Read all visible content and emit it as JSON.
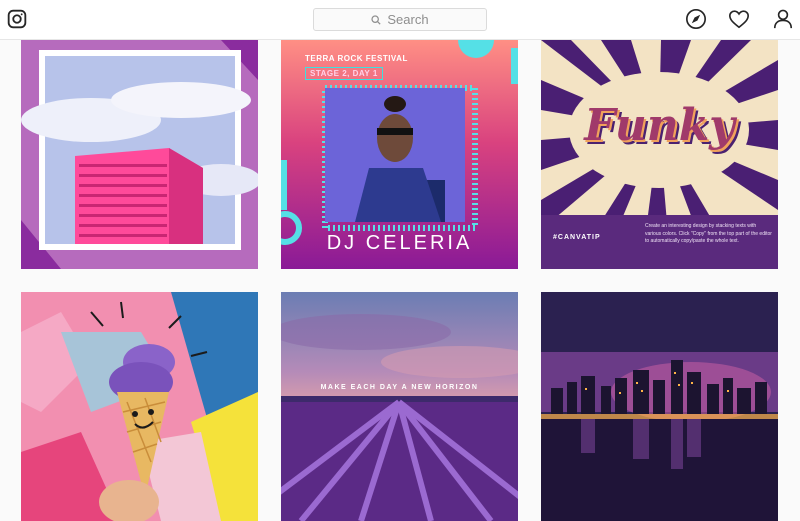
{
  "search": {
    "placeholder": "Search"
  },
  "icons": {
    "logo": "instagram-icon",
    "explore": "compass-icon",
    "activity": "heart-icon",
    "profile": "person-icon",
    "search": "search-icon"
  },
  "posts": [
    {
      "title": ""
    },
    {
      "festival": "TERRA ROCK FESTIVAL",
      "stage": "STAGE 2, DAY 1",
      "artist": "DJ CELERIA"
    },
    {
      "headline": "Funky",
      "tag": "#CANVATIP",
      "description": "Create an interesting design by stacking texts with various colors. Click \"Copy\" from the top part of the editor to automatically copy/paste the whole text."
    },
    {
      "title": ""
    },
    {
      "caption": "MAKE EACH DAY A NEW HORIZON"
    },
    {
      "title": ""
    }
  ],
  "colors": {
    "border": "#dbdbdb",
    "text": "#262626",
    "muted": "#8e8e8e"
  }
}
